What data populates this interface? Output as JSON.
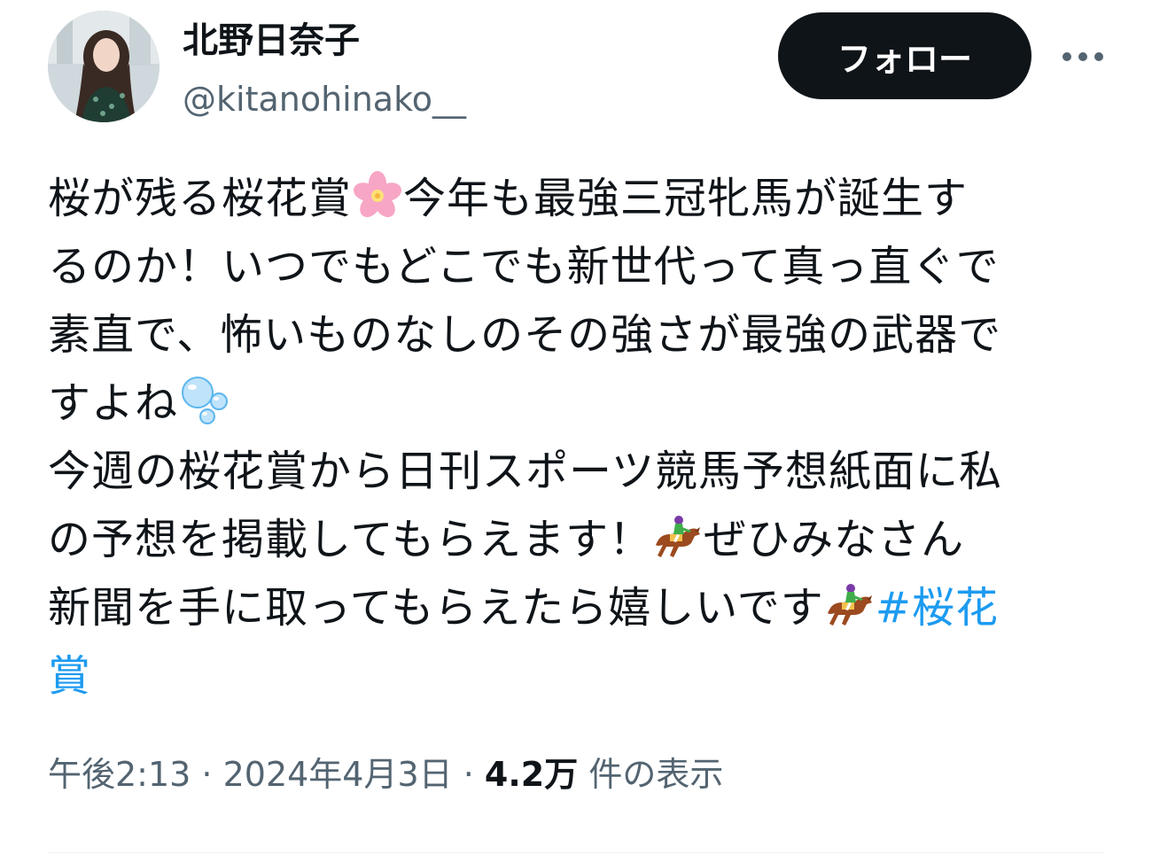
{
  "user": {
    "display_name": "北野日奈子",
    "handle": "@kitanohinako__"
  },
  "follow_label": "フォロー",
  "more_icon": "more-icon",
  "tweet": {
    "lines": [
      [
        "桜が残る桜花賞",
        "今年も最強三冠牝馬が誕生す"
      ],
      [
        "るのか！いつでもどこでも新世代って真っ直ぐで"
      ],
      [
        "素直で、怖いものなしのその強さが最強の武器で"
      ],
      [
        "すよね"
      ],
      [
        "今週の桜花賞から日刊スポーツ競馬予想紙面に私"
      ],
      [
        "の予想を掲載してもらえます！",
        "ぜひみなさん"
      ],
      [
        "新聞を手に取ってもらえたら嬉しいです"
      ],
      []
    ],
    "hashtag_part1": "#桜花",
    "hashtag_part2": "賞",
    "emojis": {
      "blossom": "cherry-blossom-icon",
      "bubbles": "bubbles-icon",
      "horse_racing": "horse-racing-icon"
    }
  },
  "meta": {
    "time": "午後2:13",
    "separator": " · ",
    "date": "2024年4月3日",
    "views_count": "4.2万",
    "views_label": " 件の表示"
  },
  "colors": {
    "text_primary": "#0f1419",
    "text_secondary": "#536471",
    "link": "#1d9bf0",
    "follow_bg": "#0f1419"
  }
}
